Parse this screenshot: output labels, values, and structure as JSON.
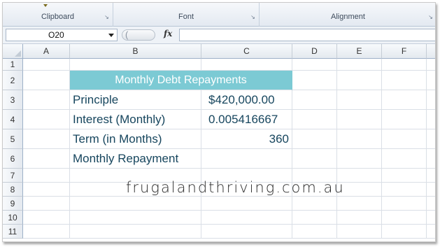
{
  "ribbon": {
    "groups": [
      {
        "label": "Clipboard",
        "launcher": "↘"
      },
      {
        "label": "Font",
        "launcher": "↘"
      },
      {
        "label": "Alignment",
        "launcher": "↘"
      }
    ]
  },
  "formula_bar": {
    "name_box": "O20",
    "fx_label": "fx",
    "formula": ""
  },
  "grid": {
    "columns": [
      "A",
      "B",
      "C",
      "D",
      "E",
      "F"
    ],
    "rows": [
      "1",
      "2",
      "3",
      "4",
      "5",
      "6",
      "7",
      "8",
      "9",
      "10",
      "11"
    ],
    "cells": {
      "B2": "Monthly Debt Repayments",
      "B3": "Principle",
      "C3": "$420,000.00",
      "B4": "Interest (Monthly)",
      "C4": "0.005416667",
      "B5": "Term (in Months)",
      "C5": "360",
      "B6": "Monthly Repayment",
      "C6": ""
    },
    "title_fill_color": "#7ccad4",
    "text_color": "#17465e"
  },
  "watermark": "frugalandthriving.com.au"
}
